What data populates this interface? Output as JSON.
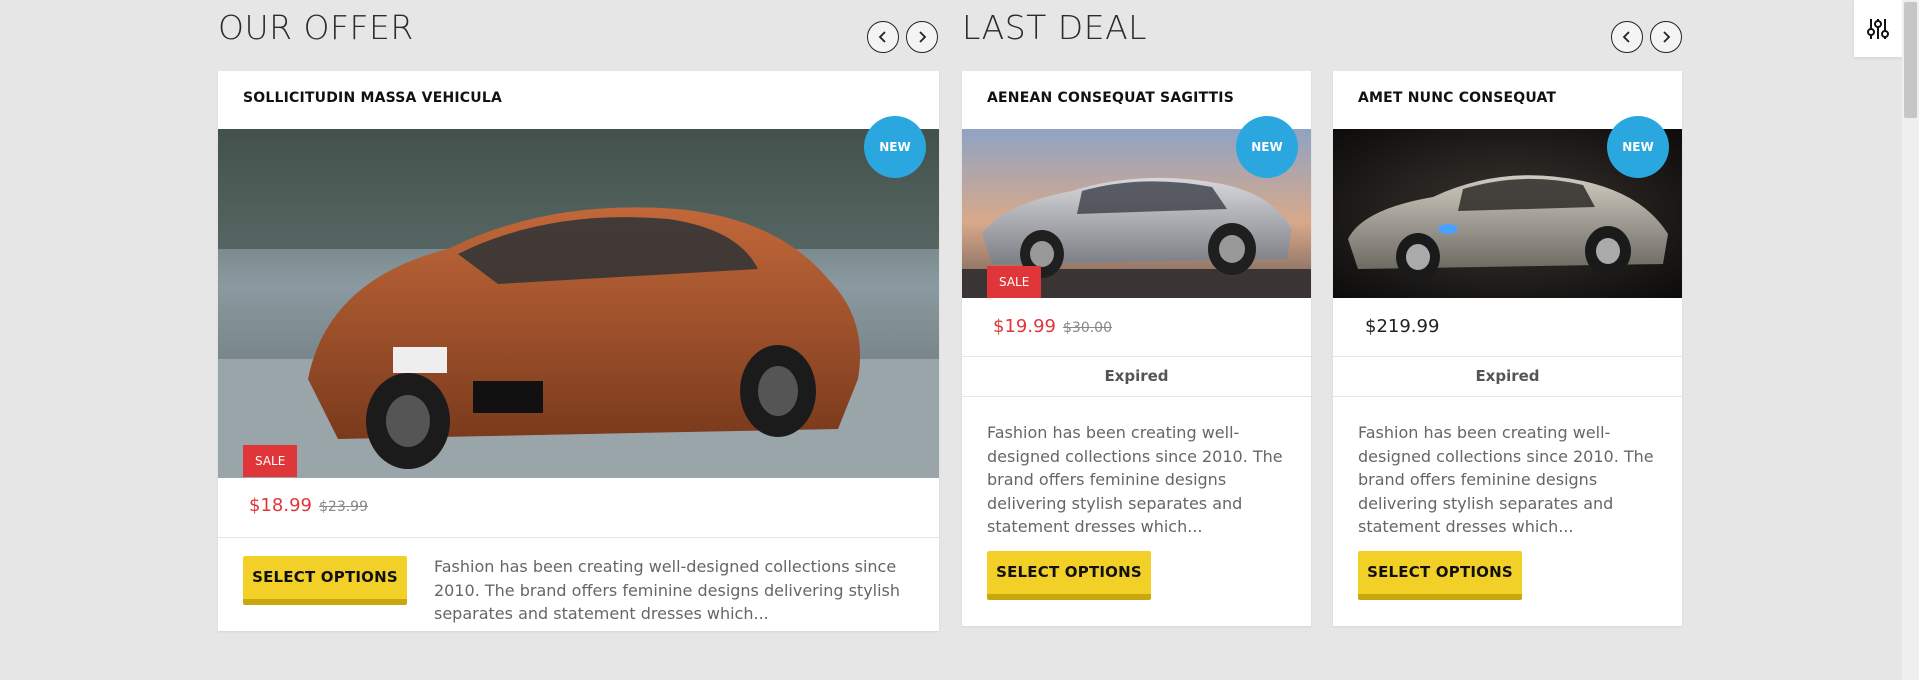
{
  "offer": {
    "heading": "OUR OFFER",
    "card": {
      "title": "SOLLICITUDIN MASSA VEHICULA",
      "badge_new": "NEW",
      "badge_sale": "SALE",
      "price": "$18.99",
      "old_price": "$23.99",
      "button": "SELECT OPTIONS",
      "description": "Fashion has been creating well-designed collections since 2010. The brand offers feminine designs delivering stylish separates and statement dresses which..."
    }
  },
  "deal": {
    "heading": "LAST DEAL",
    "cards": [
      {
        "title": "AENEAN CONSEQUAT SAGITTIS",
        "badge_new": "NEW",
        "badge_sale": "SALE",
        "price": "$19.99",
        "old_price": "$30.00",
        "status": "Expired",
        "description": "Fashion has been creating well-designed collections since 2010. The brand offers feminine designs delivering stylish separates and statement dresses which...",
        "button": "SELECT OPTIONS"
      },
      {
        "title": "AMET NUNC CONSEQUAT",
        "badge_new": "NEW",
        "price": "$219.99",
        "status": "Expired",
        "description": "Fashion has been creating well-designed collections since 2010. The brand offers feminine designs delivering stylish separates and statement dresses which...",
        "button": "SELECT OPTIONS"
      }
    ]
  },
  "icons": {
    "prev": "chevron-left-icon",
    "next": "chevron-right-icon",
    "filter": "sliders-icon"
  },
  "colors": {
    "accent_yellow": "#f2d027",
    "badge_blue": "#29a7de",
    "sale_red": "#e0363a"
  }
}
